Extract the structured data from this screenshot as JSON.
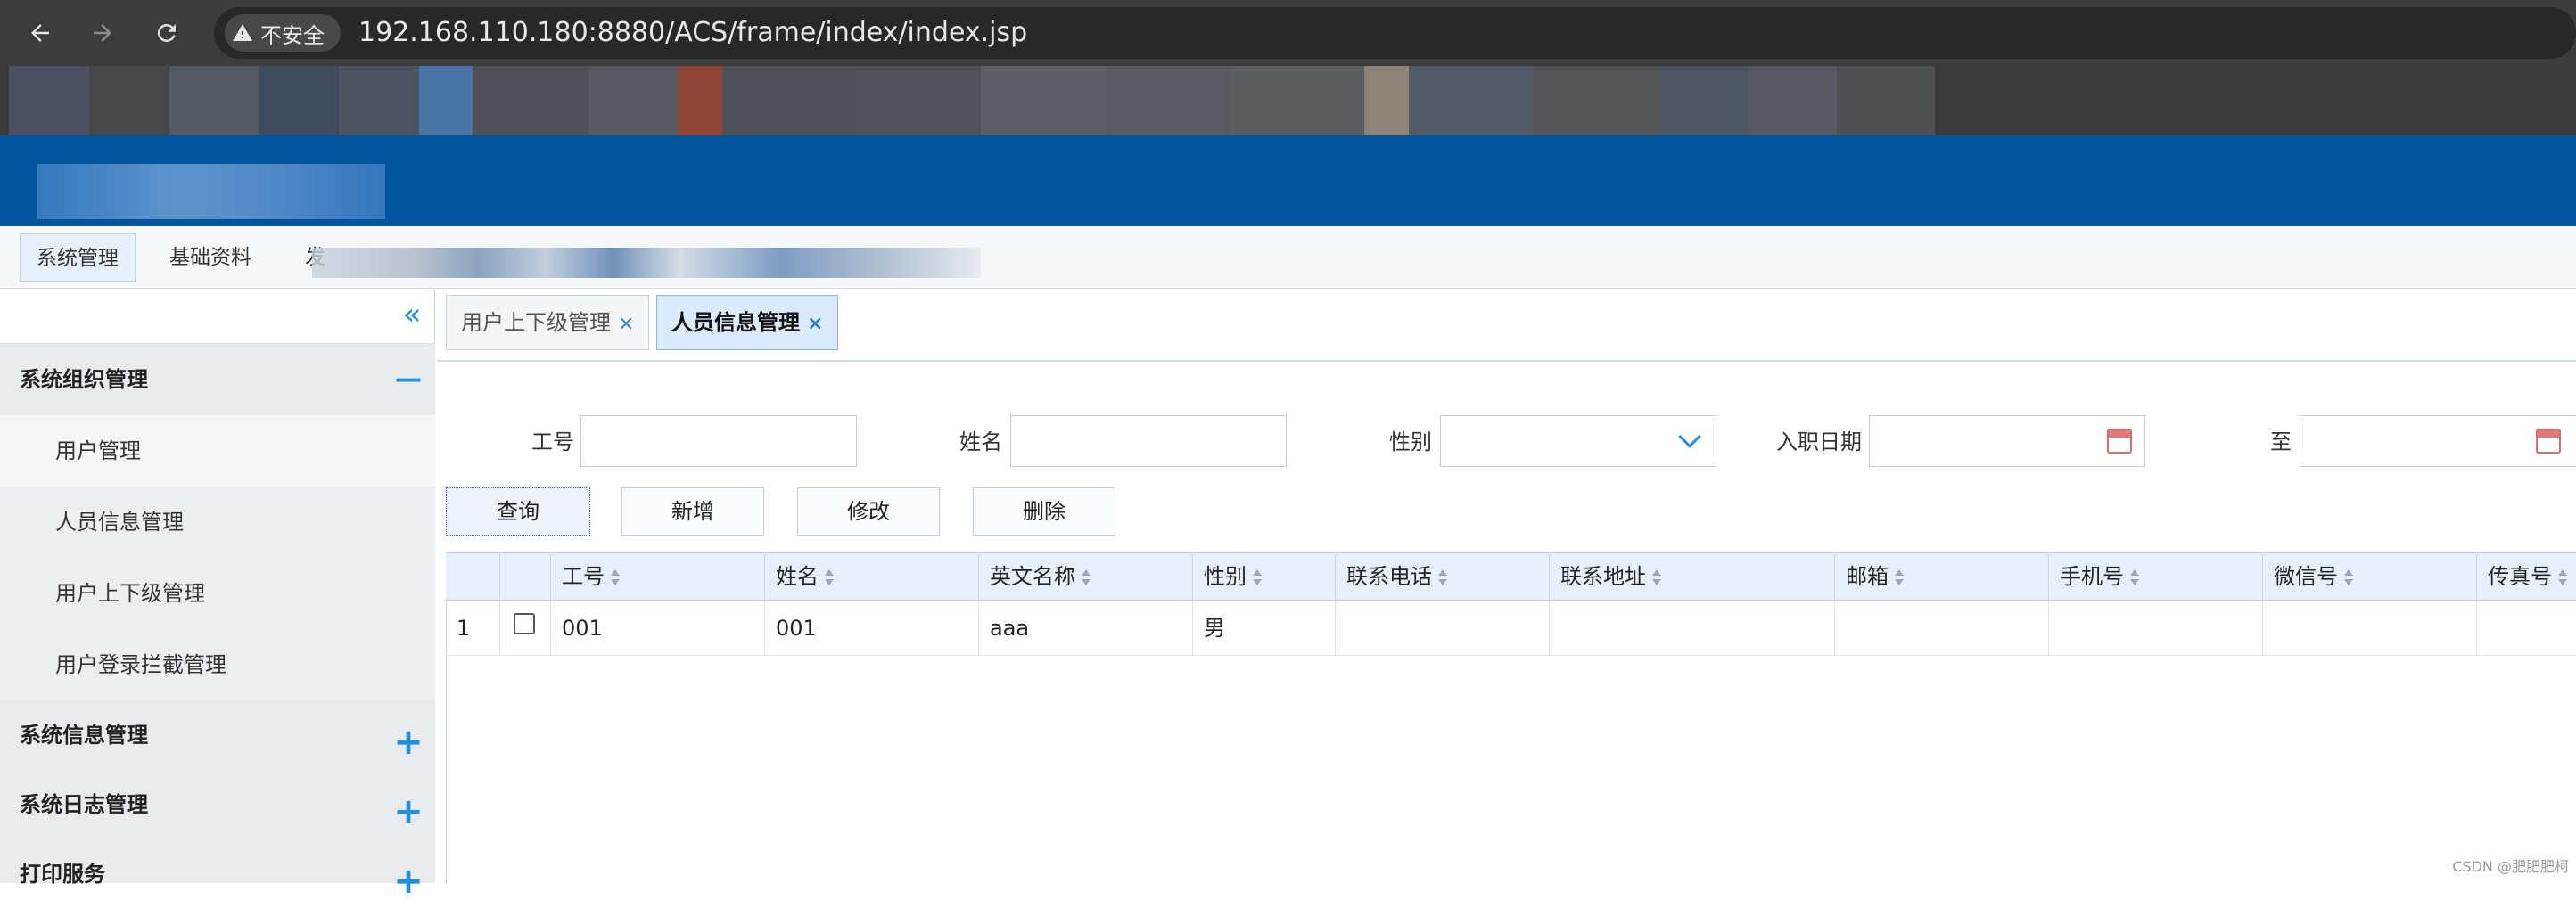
{
  "browser": {
    "security_label": "不安全",
    "url_host": "192.168.110.180",
    "url_rest": ":8880/ACS/frame/index/index.jsp"
  },
  "top_menu": {
    "items": [
      "系统管理",
      "基础资料",
      "发"
    ]
  },
  "sidebar": {
    "groups": [
      {
        "label": "系统组织管理",
        "toggle": "—",
        "items": [
          "用户管理",
          "人员信息管理",
          "用户上下级管理",
          "用户登录拦截管理"
        ]
      },
      {
        "label": "系统信息管理",
        "toggle": "+"
      },
      {
        "label": "系统日志管理",
        "toggle": "+"
      },
      {
        "label": "打印服务",
        "toggle": "+"
      }
    ]
  },
  "tabs": [
    {
      "label": "用户上下级管理",
      "close": "×"
    },
    {
      "label": "人员信息管理",
      "close": "×"
    }
  ],
  "filters": {
    "emp_no_label": "工号",
    "name_label": "姓名",
    "gender_label": "性别",
    "hire_date_label": "入职日期",
    "to_label": "至"
  },
  "buttons": {
    "query": "查询",
    "add": "新增",
    "edit": "修改",
    "delete": "删除"
  },
  "grid": {
    "columns": [
      "工号",
      "姓名",
      "英文名称",
      "性别",
      "联系电话",
      "联系地址",
      "邮箱",
      "手机号",
      "微信号",
      "传真号"
    ],
    "rows": [
      {
        "index": "1",
        "emp_no": "001",
        "name": "001",
        "english_name": "aaa",
        "gender": "男",
        "phone": "",
        "address": "",
        "email": "",
        "mobile": "",
        "wechat": "",
        "fax": ""
      }
    ]
  },
  "watermark": "CSDN @肥肥肥柯",
  "colors": {
    "header_blue": "#03559b",
    "accent_blue": "#1e90e0"
  }
}
